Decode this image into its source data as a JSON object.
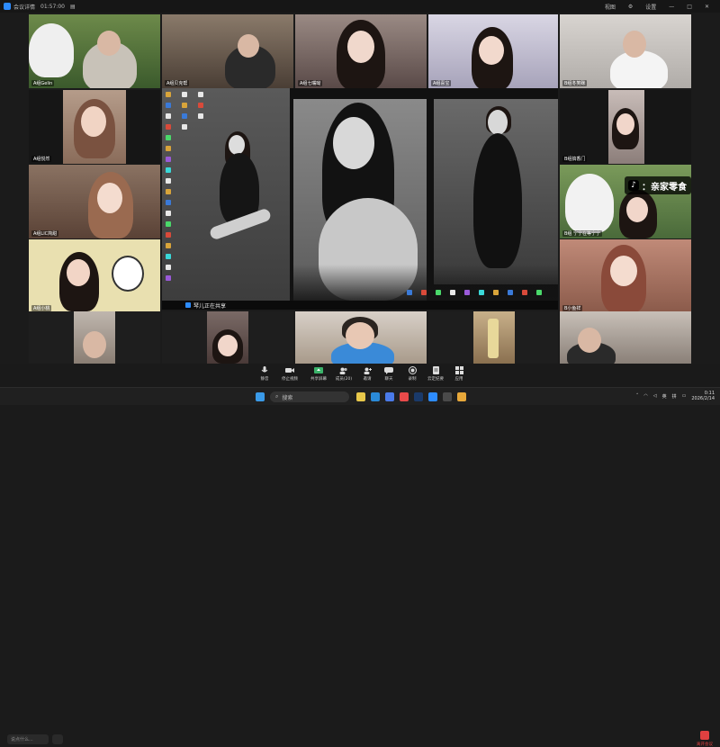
{
  "topbar": {
    "app_name": "会议详情",
    "elapsed": "01:57:00",
    "view_label": "视图",
    "settings_label": "设置"
  },
  "participants": [
    {
      "name": "A组Gelin"
    },
    {
      "name": "A组贝克帮"
    },
    {
      "name": "A组七嘴呦"
    },
    {
      "name": "A组喜宝"
    },
    {
      "name": "B组冬笑眯"
    },
    {
      "name": "A组悦然"
    },
    {
      "name": "B组搞香门"
    },
    {
      "name": "A组LIC简甜"
    },
    {
      "name": "B组 宁宁在等宁宁"
    },
    {
      "name": "A组小桃"
    },
    {
      "name": "B小鱼祥"
    }
  ],
  "overlay": {
    "tiktok_text": "：亲家零食"
  },
  "share": {
    "banner": "琴儿正在共享"
  },
  "toolbar": {
    "chat_placeholder": "说点什么...",
    "buttons": [
      {
        "label": "静音",
        "icon": "microphone-icon"
      },
      {
        "label": "停止视频",
        "icon": "camera-icon"
      },
      {
        "label": "共享屏幕",
        "icon": "share-screen-icon"
      },
      {
        "label": "成员(20)",
        "icon": "members-icon"
      },
      {
        "label": "邀请",
        "icon": "invite-icon"
      },
      {
        "label": "聊天",
        "icon": "chat-icon"
      },
      {
        "label": "录制",
        "icon": "record-icon"
      },
      {
        "label": "云定纪要",
        "icon": "notes-icon"
      },
      {
        "label": "应用",
        "icon": "apps-icon"
      }
    ],
    "leave_label": "离开会议"
  },
  "taskbar": {
    "search_placeholder": "搜索",
    "ime_lang": "英",
    "ime_mode": "拼",
    "time": "0:11",
    "date": "2026/2/14"
  },
  "colors": {
    "accent": "#2d8cff",
    "leave": "#e04040"
  }
}
